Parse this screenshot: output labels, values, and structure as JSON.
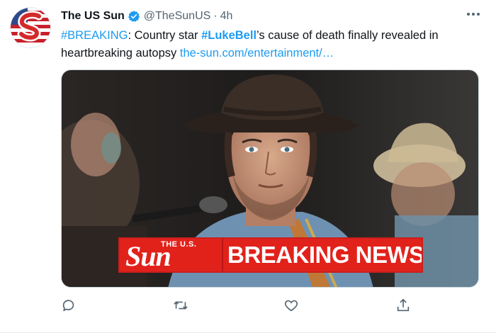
{
  "tweet": {
    "display_name": "The US Sun",
    "handle": "@TheSunUS",
    "separator": "·",
    "time": "4h",
    "text": {
      "hashtag1": "#BREAKING",
      "part1": ": Country star ",
      "hashtag2": "#LukeBell",
      "part2": "’s cause of death finally revealed in heartbreaking autopsy ",
      "link": "the-sun.com/entertainment/…"
    },
    "media": {
      "banner_logo_small": "THE U.S.",
      "banner_logo_big": "Sun",
      "banner_text": "BREAKING NEWS"
    }
  },
  "colors": {
    "accent": "#1d9bf0",
    "text": "#0f1419",
    "muted": "#536471",
    "brand_red": "#e1221b"
  },
  "icons": {
    "verified": "verified-badge-icon",
    "more": "more-icon",
    "reply": "reply-icon",
    "retweet": "retweet-icon",
    "like": "like-icon",
    "share": "share-icon"
  }
}
